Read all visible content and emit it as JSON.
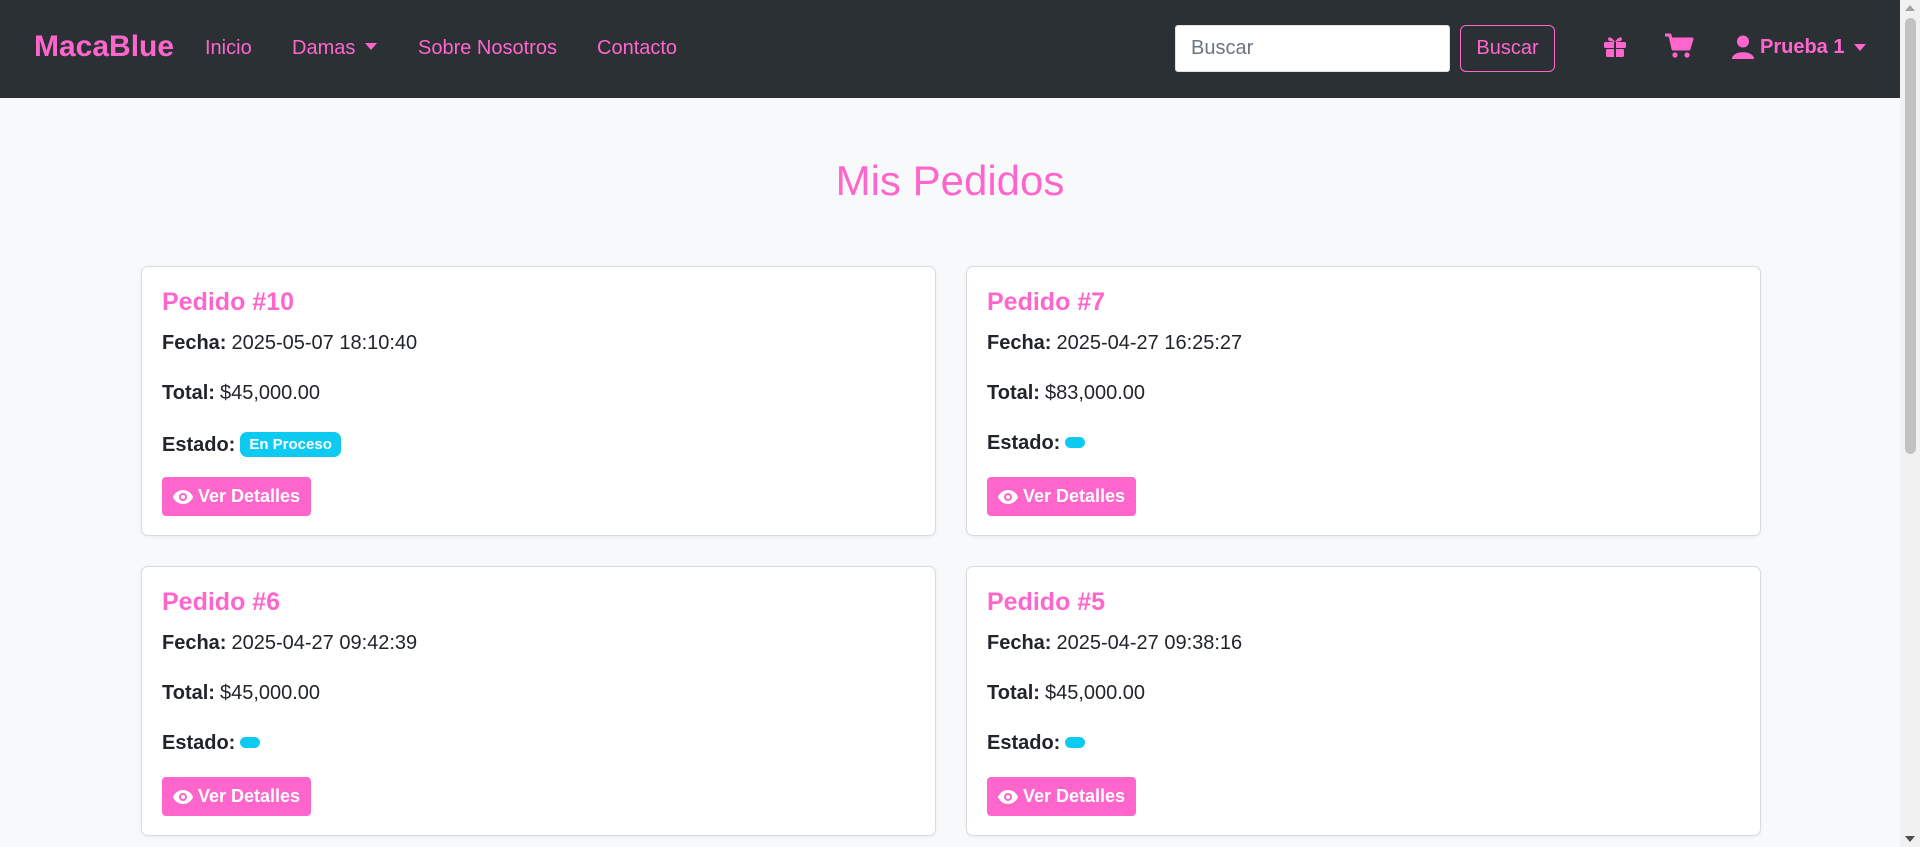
{
  "navbar": {
    "brand": "MacaBlue",
    "links": [
      "Inicio",
      "Damas",
      "Sobre Nosotros",
      "Contacto"
    ],
    "search_placeholder": "Buscar",
    "search_button": "Buscar",
    "user_name": "Prueba 1",
    "icons": [
      "gift-icon",
      "cart-icon",
      "user-icon"
    ]
  },
  "page": {
    "title": "Mis Pedidos"
  },
  "labels": {
    "fecha": "Fecha:",
    "total": "Total:",
    "estado": "Estado:",
    "details_button": "Ver Detalles"
  },
  "orders": [
    {
      "title": "Pedido #10",
      "fecha": "2025-05-07 18:10:40",
      "total": "$45,000.00",
      "estado": "En Proceso"
    },
    {
      "title": "Pedido #7",
      "fecha": "2025-04-27 16:25:27",
      "total": "$83,000.00",
      "estado": ""
    },
    {
      "title": "Pedido #6",
      "fecha": "2025-04-27 09:42:39",
      "total": "$45,000.00",
      "estado": ""
    },
    {
      "title": "Pedido #5",
      "fecha": "2025-04-27 09:38:16",
      "total": "$45,000.00",
      "estado": ""
    }
  ],
  "colors": {
    "accent": "#ff66cc",
    "navbar_bg": "#2b3035",
    "badge_bg": "#0dcaf0",
    "page_bg": "#f8f9fa"
  }
}
